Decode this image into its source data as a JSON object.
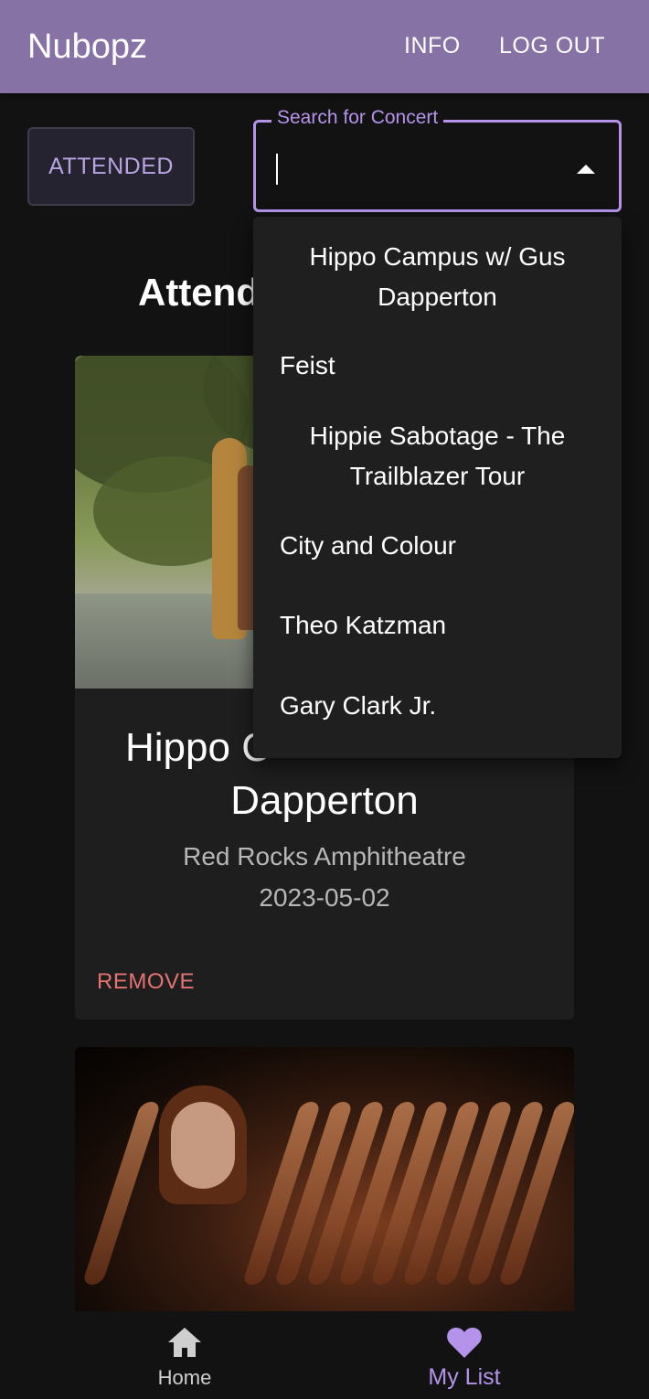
{
  "app": {
    "title": "Nubopz"
  },
  "nav": {
    "info": "INFO",
    "logout": "LOG OUT"
  },
  "filter": {
    "attended_label": "ATTENDED"
  },
  "search": {
    "label": "Search for Concert",
    "value": ""
  },
  "section": {
    "heading_visible": "Attend"
  },
  "dropdown": {
    "options": [
      "Hippo Campus w/ Gus Dapperton",
      "Feist",
      "Hippie Sabotage - The Trailblazer Tour",
      "City and Colour",
      "Theo Katzman",
      "Gary Clark Jr."
    ]
  },
  "cards": [
    {
      "title_partial": "Hippo C",
      "title_line2": "Dapperton",
      "venue": "Red Rocks Amphitheatre",
      "date": "2023-05-02",
      "remove_label": "REMOVE"
    }
  ],
  "bottom_nav": {
    "home": {
      "label": "Home",
      "icon": "home-icon"
    },
    "my_list": {
      "label": "My List",
      "icon": "heart-icon"
    }
  },
  "colors": {
    "appbar": "#8672a4",
    "accent": "#b593ea",
    "danger": "#e57373",
    "background": "#121212",
    "surface": "#1e1e1e"
  }
}
